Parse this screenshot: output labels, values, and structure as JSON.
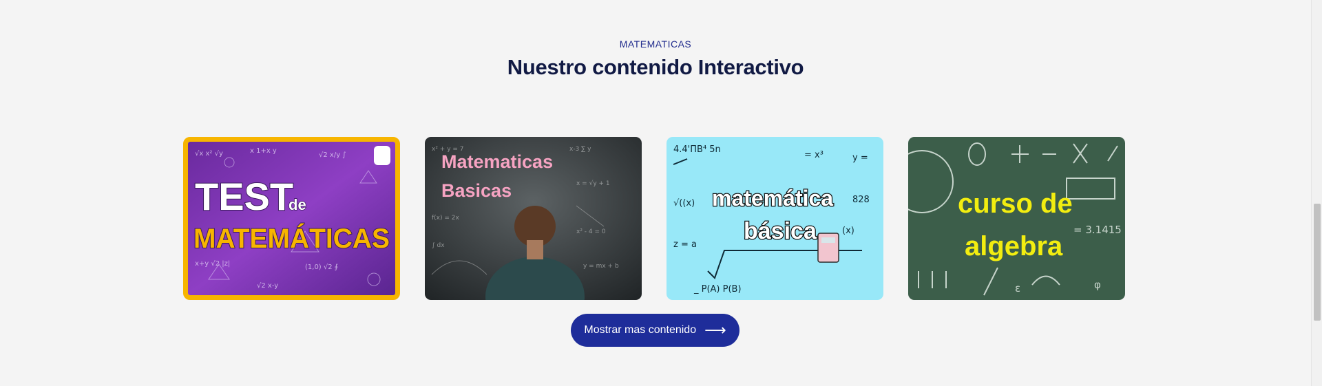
{
  "section": {
    "eyebrow": "MATEMATICAS",
    "title": "Nuestro contenido Interactivo"
  },
  "cards": [
    {
      "label_line1": "TEST",
      "label_line2": "de",
      "label_line3": "MATEMÁTICAS"
    },
    {
      "label_line1": "Matematicas",
      "label_line2": "Basicas"
    },
    {
      "label_line1": "matemática",
      "label_line2": "básica"
    },
    {
      "label_line1": "curso de",
      "label_line2": "algebra"
    }
  ],
  "button": {
    "label": "Mostrar mas contenido",
    "icon": "arrow-right-icon"
  },
  "colors": {
    "background": "#f4f4f4",
    "eyebrow": "#1f2a8c",
    "title": "#111a44",
    "button": "#1e2d9a",
    "card1_border": "#f7b500"
  }
}
